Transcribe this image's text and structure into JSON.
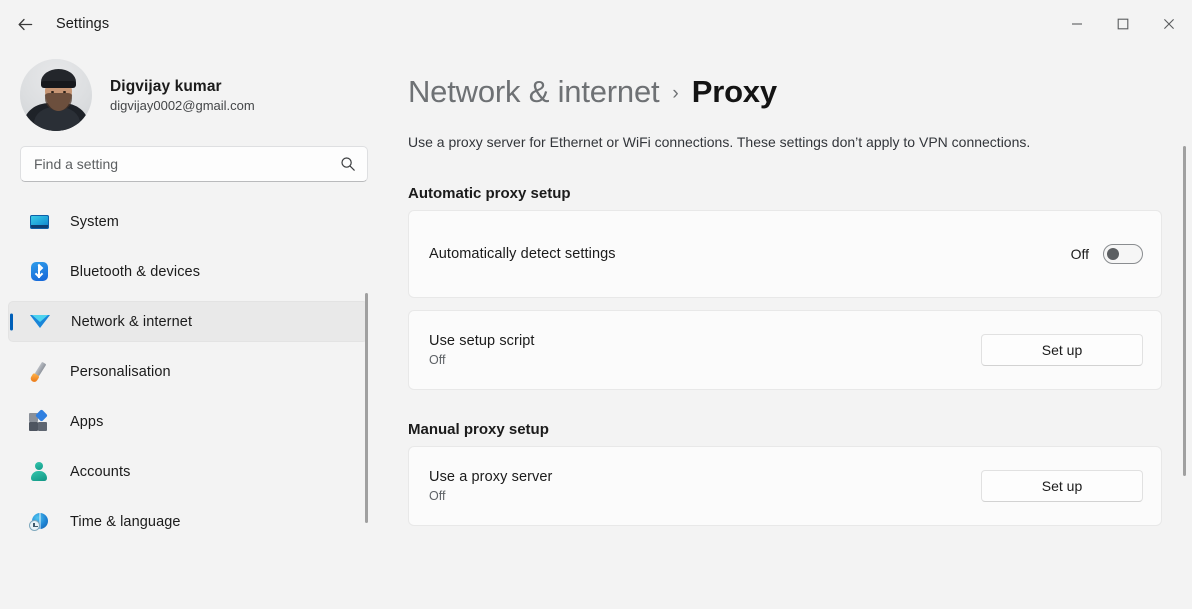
{
  "window": {
    "app_title": "Settings",
    "back_label": "Back",
    "controls": {
      "minimize": "Minimize",
      "maximize": "Maximize",
      "close": "Close"
    }
  },
  "accent_color": "#005fb8",
  "page_background": "#f3f3f3",
  "card_background": "#fbfbfb",
  "sidebar": {
    "profile": {
      "name": "Digvijay kumar",
      "email": "digvijay0002@gmail.com",
      "avatar_icon": "user-photo-avatar"
    },
    "search": {
      "placeholder": "Find a setting",
      "value": "",
      "icon": "search-icon"
    },
    "items": [
      {
        "label": "System",
        "icon": "monitor-icon",
        "selected": false
      },
      {
        "label": "Bluetooth & devices",
        "icon": "bluetooth-icon",
        "selected": false
      },
      {
        "label": "Network & internet",
        "icon": "wifi-icon",
        "selected": true
      },
      {
        "label": "Personalisation",
        "icon": "paintbrush-icon",
        "selected": false
      },
      {
        "label": "Apps",
        "icon": "apps-blocks-icon",
        "selected": false
      },
      {
        "label": "Accounts",
        "icon": "person-icon",
        "selected": false
      },
      {
        "label": "Time & language",
        "icon": "globe-clock-icon",
        "selected": false
      }
    ]
  },
  "main": {
    "breadcrumb": {
      "parent": "Network & internet",
      "separator": "›",
      "current": "Proxy"
    },
    "description": "Use a proxy server for Ethernet or WiFi connections. These settings don’t apply to VPN connections.",
    "sections": [
      {
        "title": "Automatic proxy setup",
        "rows": [
          {
            "title": "Automatically detect settings",
            "subtitle": "",
            "control": "toggle",
            "state_label": "Off",
            "toggle_on": false
          },
          {
            "title": "Use setup script",
            "subtitle": "Off",
            "control": "button",
            "button_label": "Set up"
          }
        ]
      },
      {
        "title": "Manual proxy setup",
        "rows": [
          {
            "title": "Use a proxy server",
            "subtitle": "Off",
            "control": "button",
            "button_label": "Set up"
          }
        ]
      }
    ]
  }
}
